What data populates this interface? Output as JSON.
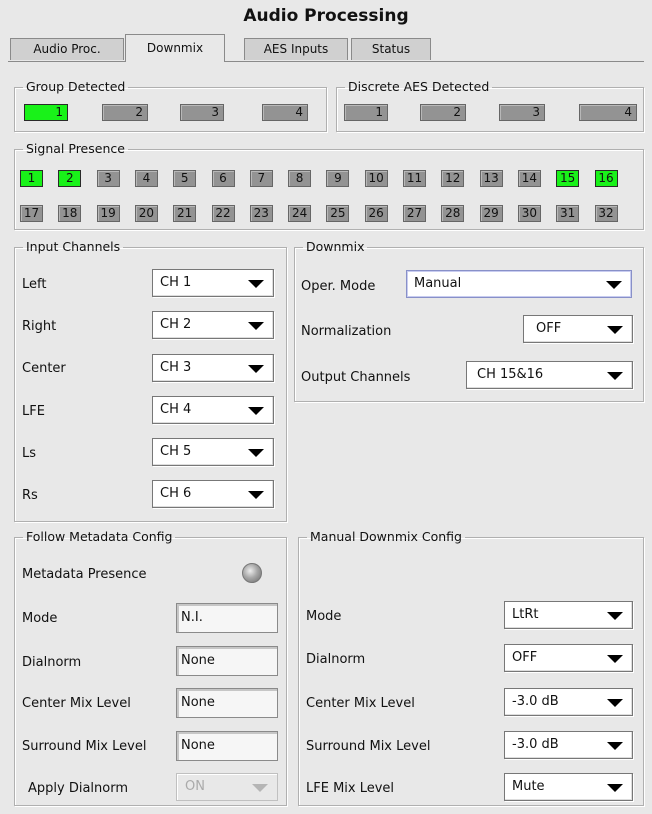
{
  "window": {
    "title": "Audio Processing"
  },
  "tabs": [
    {
      "label": "Audio Proc."
    },
    {
      "label": "Downmix",
      "active": true
    },
    {
      "label": "AES Inputs"
    },
    {
      "label": "Status"
    }
  ],
  "group_detected": {
    "legend": "Group Detected",
    "items": [
      {
        "label": "1",
        "on": true
      },
      {
        "label": "2",
        "on": false
      },
      {
        "label": "3",
        "on": false
      },
      {
        "label": "4",
        "on": false
      }
    ]
  },
  "discrete_aes": {
    "legend": "Discrete AES Detected",
    "items": [
      {
        "label": "1",
        "on": false
      },
      {
        "label": "2",
        "on": false
      },
      {
        "label": "3",
        "on": false
      },
      {
        "label": "4",
        "on": false
      }
    ]
  },
  "signal_presence": {
    "legend": "Signal Presence",
    "channels": [
      "1",
      "2",
      "3",
      "4",
      "5",
      "6",
      "7",
      "8",
      "9",
      "10",
      "11",
      "12",
      "13",
      "14",
      "15",
      "16",
      "17",
      "18",
      "19",
      "20",
      "21",
      "22",
      "23",
      "24",
      "25",
      "26",
      "27",
      "28",
      "29",
      "30",
      "31",
      "32"
    ],
    "active": [
      "1",
      "2",
      "15",
      "16"
    ]
  },
  "input_channels": {
    "legend": "Input Channels",
    "rows": [
      {
        "label": "Left",
        "value": "CH 1"
      },
      {
        "label": "Right",
        "value": "CH 2"
      },
      {
        "label": "Center",
        "value": "CH 3"
      },
      {
        "label": "LFE",
        "value": "CH 4"
      },
      {
        "label": "Ls",
        "value": "CH 5"
      },
      {
        "label": "Rs",
        "value": "CH 6"
      }
    ]
  },
  "downmix": {
    "legend": "Downmix",
    "oper_mode_label": "Oper. Mode",
    "oper_mode_value": "Manual",
    "normalization_label": "Normalization",
    "normalization_value": "OFF",
    "output_channels_label": "Output Channels",
    "output_channels_value": "CH 15&16"
  },
  "follow_metadata": {
    "legend": "Follow Metadata Config",
    "presence_label": "Metadata Presence",
    "mode_label": "Mode",
    "mode_value": "N.I.",
    "dialnorm_label": "Dialnorm",
    "dialnorm_value": "None",
    "center_mix_label": "Center Mix Level",
    "center_mix_value": "None",
    "surround_mix_label": "Surround Mix Level",
    "surround_mix_value": "None",
    "apply_dialnorm_label": "Apply Dialnorm",
    "apply_dialnorm_value": "ON"
  },
  "manual_downmix": {
    "legend": "Manual Downmix Config",
    "mode_label": "Mode",
    "mode_value": "LtRt",
    "dialnorm_label": "Dialnorm",
    "dialnorm_value": "OFF",
    "center_mix_label": "Center Mix Level",
    "center_mix_value": "-3.0 dB",
    "surround_mix_label": "Surround Mix Level",
    "surround_mix_value": "-3.0 dB",
    "lfe_mix_label": "LFE Mix Level",
    "lfe_mix_value": "Mute"
  },
  "colors": {
    "indicator_on": "#19f219",
    "indicator_off": "#939393",
    "panel": "#e8e8e8"
  }
}
